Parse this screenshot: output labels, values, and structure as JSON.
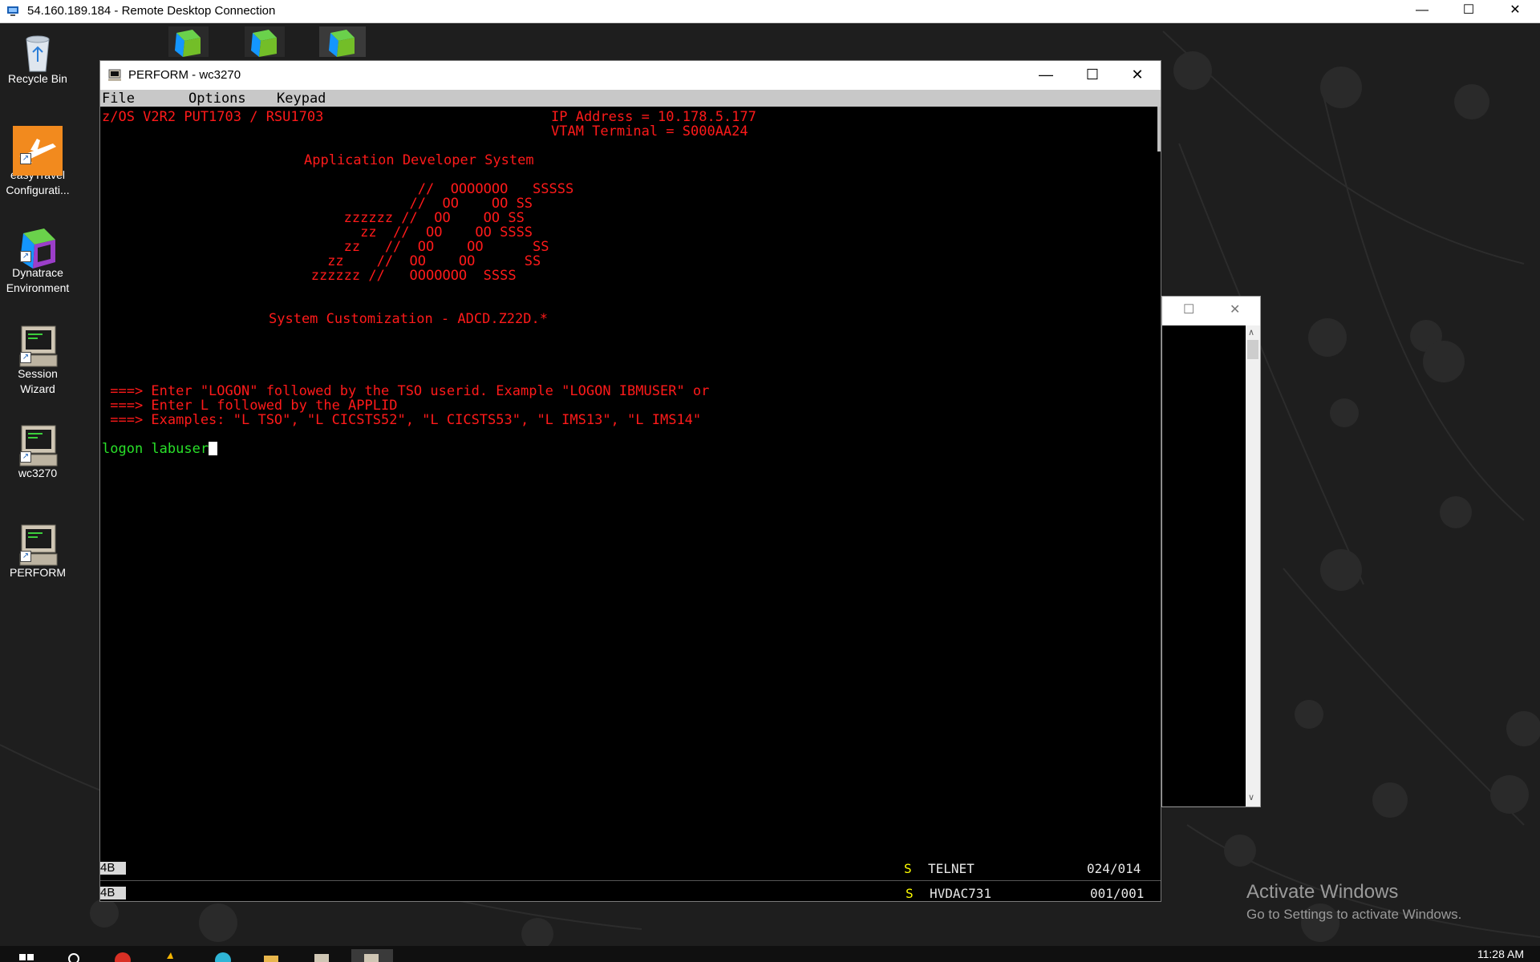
{
  "rdp": {
    "title": "54.160.189.184 - Remote Desktop Connection",
    "minimize": "—",
    "maximize": "☐",
    "close": "✕"
  },
  "desktop_icons": [
    {
      "label": "Recycle Bin",
      "icon": "recycle-bin-icon"
    },
    {
      "label": "easyTravel Configurati...",
      "icon": "easytravel-plane-icon"
    },
    {
      "label": "Dynatrace Environment",
      "icon": "dynatrace-logo-icon"
    },
    {
      "label": "Session Wizard",
      "icon": "terminal-computer-icon"
    },
    {
      "label": "wc3270",
      "icon": "terminal-computer-icon"
    },
    {
      "label": "PERFORM",
      "icon": "terminal-computer-icon"
    }
  ],
  "window": {
    "title": "PERFORM - wc3270",
    "minimize": "—",
    "maximize": "☐",
    "close": "✕",
    "menu": [
      "File",
      "Options",
      "Keypad"
    ]
  },
  "terminal": {
    "header_left": "z/OS V2R2 PUT1703 / RSU1703",
    "ip_line": "IP Address = 10.178.5.177",
    "vtam_line": "VTAM Terminal = S000AA24",
    "app_title": "Application Developer System",
    "logo": [
      "                //  OOOOOOO   SSSSS",
      "               //  OO    OO SS",
      "       zzzzzz //  OO    OO SS",
      "         zz  //  OO    OO SSSS",
      "       zz   //  OO    OO      SS",
      "     zz    //  OO    OO      SS",
      "   zzzzzz //   OOOOOOO  SSSS"
    ],
    "customization": "System Customization - ADCD.Z22D.*",
    "prompts": [
      " ===> Enter \"LOGON\" followed by the TSO userid. Example \"LOGON IBMUSER\" or",
      " ===> Enter L followed by the APPLID",
      " ===> Examples: \"L TSO\", \"L CICSTS52\", \"L CICSTS53\", \"L IMS13\", \"L IMS14\""
    ],
    "input": "logon labuser"
  },
  "status1": {
    "box": "4B",
    "flag": "S",
    "name": "TELNET",
    "pos": "024/014"
  },
  "status2": {
    "box": "4B",
    "flag": "S",
    "name": "HVDAC731",
    "pos": "001/001"
  },
  "window2": {
    "maximize": "☐",
    "close": "✕",
    "up": "∧",
    "down": "∨"
  },
  "activate": {
    "line1": "Activate Windows",
    "line2": "Go to Settings to activate Windows."
  },
  "taskbar": {
    "clock": "11:28 AM"
  },
  "colors": {
    "terminal_red": "#ff1a1a",
    "terminal_green": "#29e029",
    "status_yellow": "#ffff00"
  }
}
